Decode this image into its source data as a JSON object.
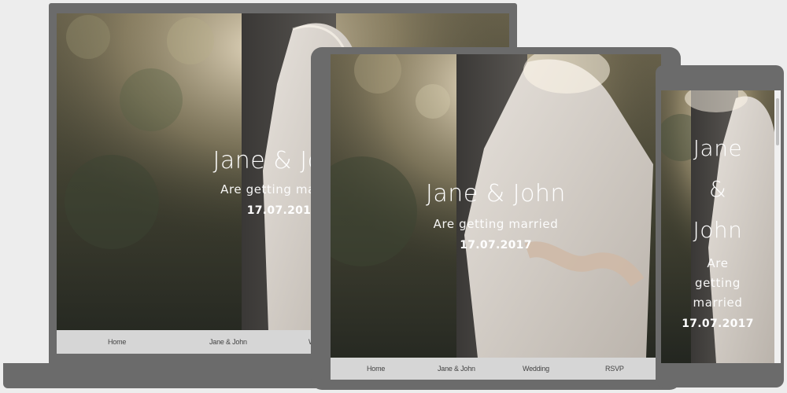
{
  "hero": {
    "names": "Jane & John",
    "names_stacked": [
      "Jane",
      "&",
      "John"
    ],
    "subtitle": "Are getting married",
    "subtitle_stacked": [
      "Are",
      "getting",
      "married"
    ],
    "date": "17.07.2017"
  },
  "nav": {
    "items": [
      "Home",
      "Jane & John",
      "Wedding",
      "RSVP"
    ]
  },
  "colors": {
    "device_frame": "#6b6b6b",
    "nav_background": "#d6d6d6",
    "page_background": "#ededed",
    "text": "#ffffff"
  }
}
